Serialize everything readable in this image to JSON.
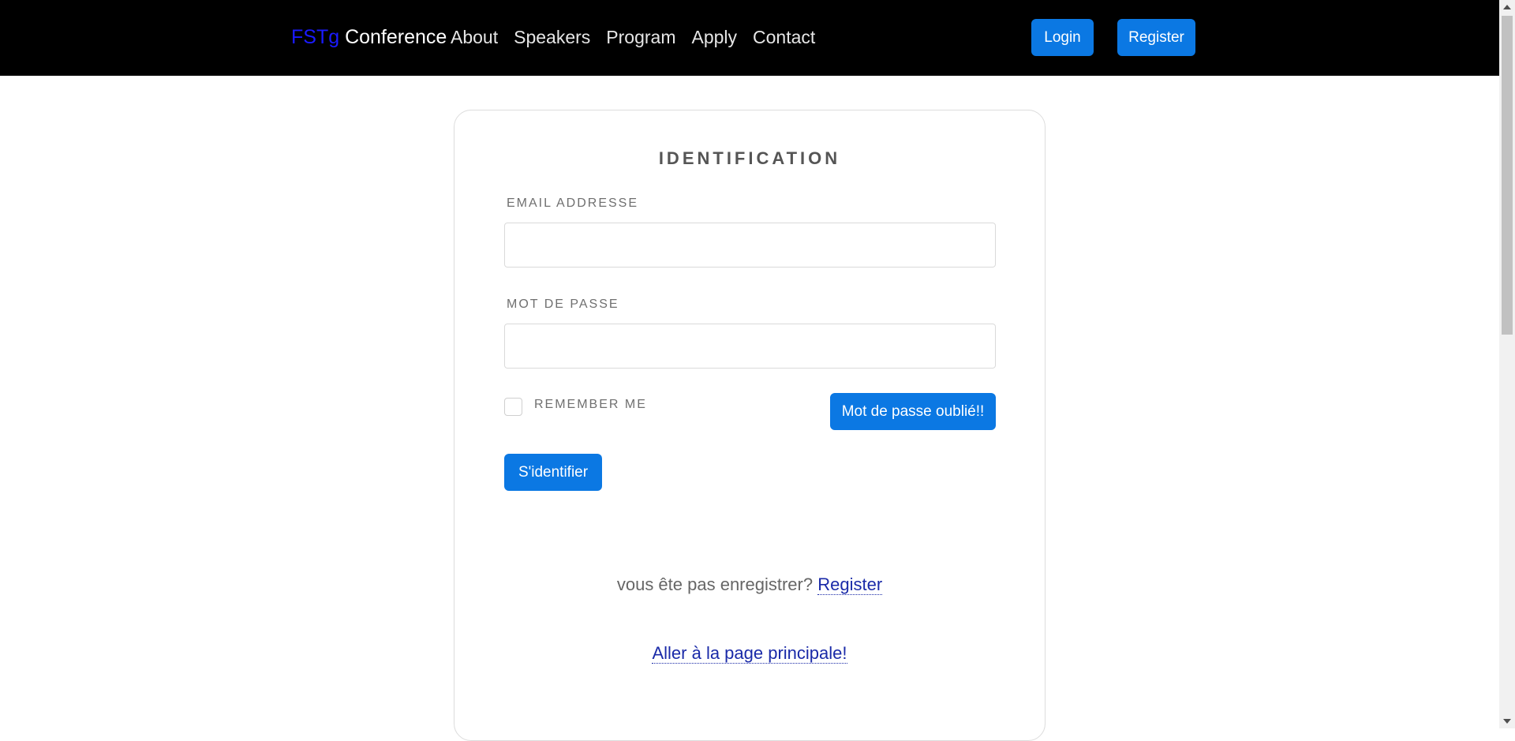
{
  "navbar": {
    "brand_accent": "FSTg",
    "brand_rest": " Conference",
    "links": [
      "About",
      "Speakers",
      "Program",
      "Apply",
      "Contact"
    ],
    "login_label": "Login",
    "register_label": "Register"
  },
  "form": {
    "title": "IDENTIFICATION",
    "email_label": "EMAIL ADDRESSE",
    "email_value": "",
    "password_label": "MOT DE PASSE",
    "password_value": "",
    "remember_label": "REMEMBER ME",
    "remember_checked": false,
    "forgot_label": "Mot de passe oublié!!",
    "submit_label": "S'identifier",
    "register_prompt": "vous ête pas enregistrer? ",
    "register_link": "Register",
    "home_link": "Aller à la page principale!"
  },
  "colors": {
    "accent_blue": "#0b78e3",
    "brand_blue": "#1a1aff",
    "link_blue": "#1a2aa8",
    "navbar_bg": "#000000"
  }
}
